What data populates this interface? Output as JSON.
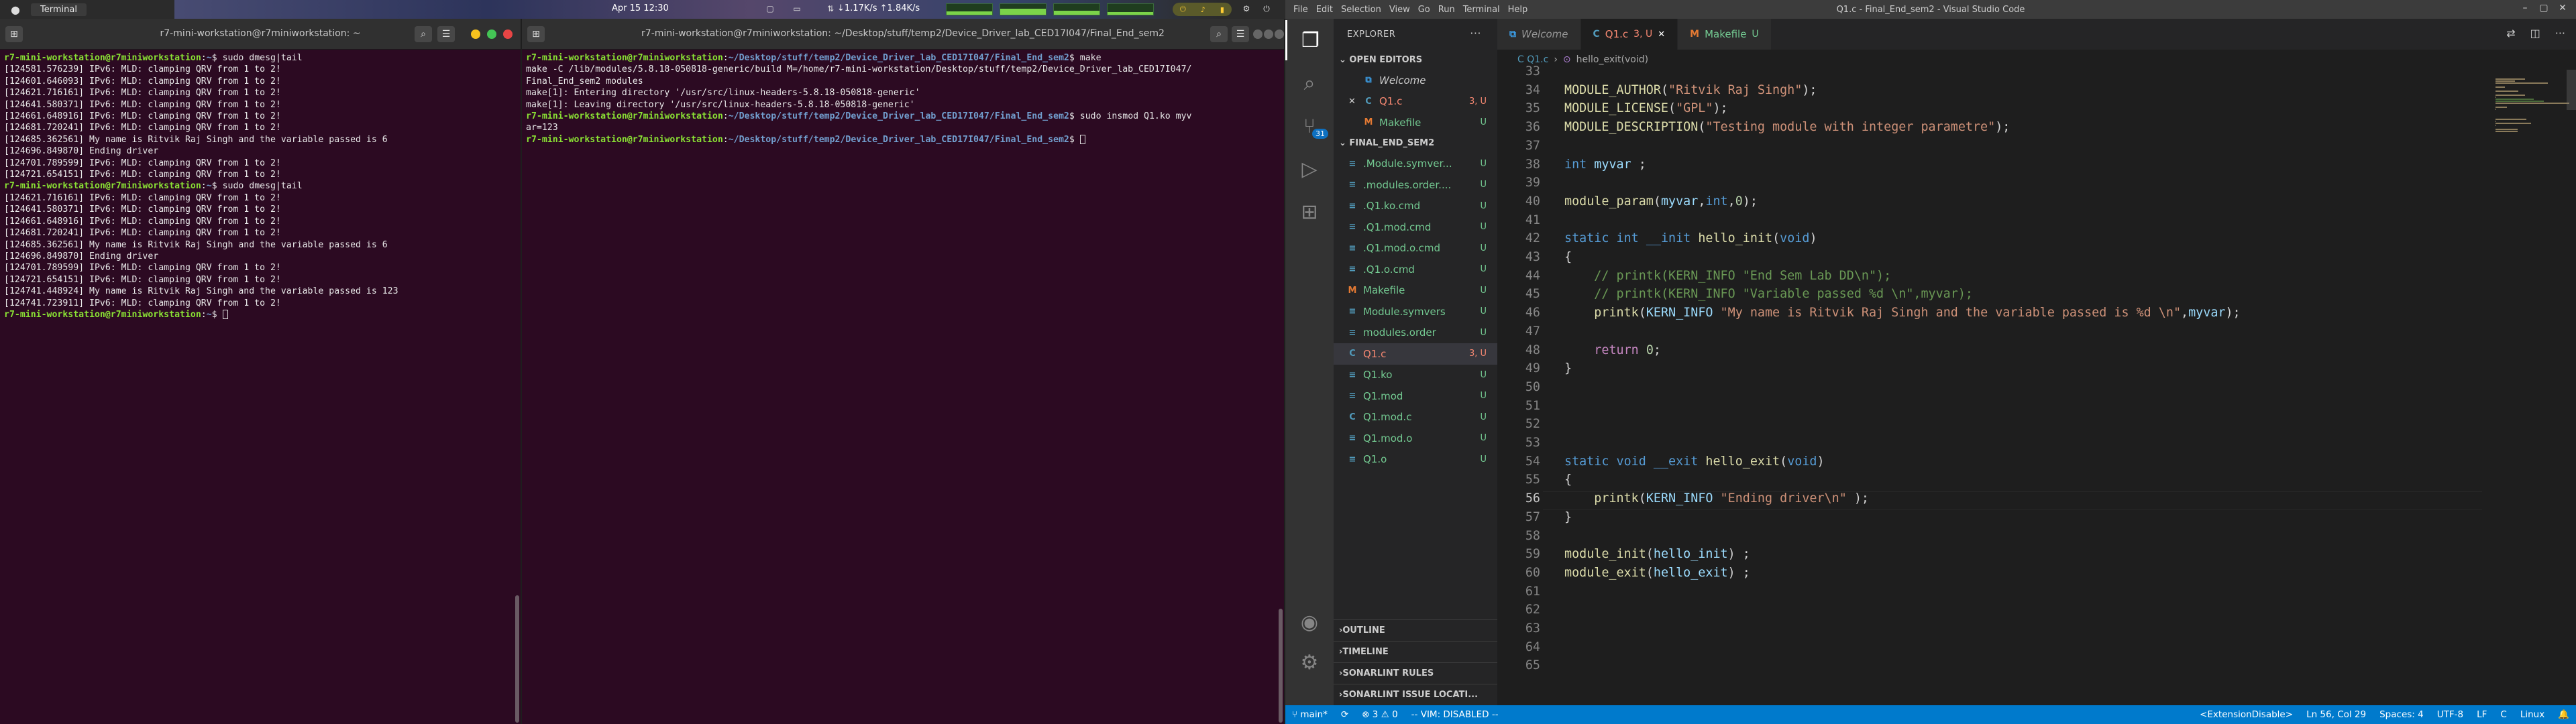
{
  "panel": {
    "app_name": "Terminal",
    "clock": "Apr 15  12:30",
    "net_speed": "↓1.17K/s  ↑1.84K/s",
    "graphs": [
      {
        "level": 0.3
      },
      {
        "level": 0.55
      },
      {
        "level": 0.4
      },
      {
        "level": 0.25
      }
    ]
  },
  "terminal_left": {
    "title": "r7-mini-workstation@r7miniworkstation: ~",
    "lines": [
      {
        "type": "prompt",
        "user": "r7-mini-workstation@r7miniworkstation",
        "path": "~",
        "cmd": "sudo dmesg|tail"
      },
      {
        "type": "text",
        "text": "[124581.576239] IPv6: MLD: clamping QRV from 1 to 2!"
      },
      {
        "type": "text",
        "text": "[124601.646093] IPv6: MLD: clamping QRV from 1 to 2!"
      },
      {
        "type": "text",
        "text": "[124621.716161] IPv6: MLD: clamping QRV from 1 to 2!"
      },
      {
        "type": "text",
        "text": "[124641.580371] IPv6: MLD: clamping QRV from 1 to 2!"
      },
      {
        "type": "text",
        "text": "[124661.648916] IPv6: MLD: clamping QRV from 1 to 2!"
      },
      {
        "type": "text",
        "text": "[124681.720241] IPv6: MLD: clamping QRV from 1 to 2!"
      },
      {
        "type": "text",
        "text": "[124685.362561] My name is Ritvik Raj Singh and the variable passed is 6"
      },
      {
        "type": "text",
        "text": "[124696.849870] Ending driver"
      },
      {
        "type": "text",
        "text": "[124701.789599] IPv6: MLD: clamping QRV from 1 to 2!"
      },
      {
        "type": "text",
        "text": "[124721.654151] IPv6: MLD: clamping QRV from 1 to 2!"
      },
      {
        "type": "prompt",
        "user": "r7-mini-workstation@r7miniworkstation",
        "path": "~",
        "cmd": "sudo dmesg|tail"
      },
      {
        "type": "text",
        "text": "[124621.716161] IPv6: MLD: clamping QRV from 1 to 2!"
      },
      {
        "type": "text",
        "text": "[124641.580371] IPv6: MLD: clamping QRV from 1 to 2!"
      },
      {
        "type": "text",
        "text": "[124661.648916] IPv6: MLD: clamping QRV from 1 to 2!"
      },
      {
        "type": "text",
        "text": "[124681.720241] IPv6: MLD: clamping QRV from 1 to 2!"
      },
      {
        "type": "text",
        "text": "[124685.362561] My name is Ritvik Raj Singh and the variable passed is 6"
      },
      {
        "type": "text",
        "text": "[124696.849870] Ending driver"
      },
      {
        "type": "text",
        "text": "[124701.789599] IPv6: MLD: clamping QRV from 1 to 2!"
      },
      {
        "type": "text",
        "text": "[124721.654151] IPv6: MLD: clamping QRV from 1 to 2!"
      },
      {
        "type": "text",
        "text": "[124741.448924] My name is Ritvik Raj Singh and the variable passed is 123"
      },
      {
        "type": "text",
        "text": "[124741.723911] IPv6: MLD: clamping QRV from 1 to 2!"
      },
      {
        "type": "prompt",
        "user": "r7-mini-workstation@r7miniworkstation",
        "path": "~",
        "cmd": "",
        "cursor": true
      }
    ]
  },
  "terminal_right": {
    "title": "r7-mini-workstation@r7miniworkstation: ~/Desktop/stuff/temp2/Device_Driver_lab_CED17I047/Final_End_sem2",
    "lines": [
      {
        "type": "prompt",
        "user": "r7-mini-workstation@r7miniworkstation",
        "path": "~/Desktop/stuff/temp2/Device_Driver_lab_CED17I047/Final_End_sem2",
        "cmd": "make"
      },
      {
        "type": "text",
        "text": "make -C /lib/modules/5.8.18-050818-generic/build M=/home/r7-mini-workstation/Desktop/stuff/temp2/Device_Driver_lab_CED17I047/"
      },
      {
        "type": "text",
        "text": "Final_End_sem2 modules"
      },
      {
        "type": "text",
        "text": "make[1]: Entering directory '/usr/src/linux-headers-5.8.18-050818-generic'"
      },
      {
        "type": "text",
        "text": "make[1]: Leaving directory '/usr/src/linux-headers-5.8.18-050818-generic'"
      },
      {
        "type": "prompt",
        "user": "r7-mini-workstation@r7miniworkstation",
        "path": "~/Desktop/stuff/temp2/Device_Driver_lab_CED17I047/Final_End_sem2",
        "cmd": "sudo insmod Q1.ko myv"
      },
      {
        "type": "text",
        "text": "ar=123"
      },
      {
        "type": "prompt",
        "user": "r7-mini-workstation@r7miniworkstation",
        "path": "~/Desktop/stuff/temp2/Device_Driver_lab_CED17I047/Final_End_sem2",
        "cmd": "",
        "cursor": true
      }
    ]
  },
  "vscode": {
    "window_title": "Q1.c - Final_End_sem2 - Visual Studio Code",
    "menu": [
      "File",
      "Edit",
      "Selection",
      "View",
      "Go",
      "Run",
      "Terminal",
      "Help"
    ],
    "scm_badge": "31",
    "explorer_title": "EXPLORER",
    "open_editors_label": "OPEN EDITORS",
    "open_editors": [
      {
        "icon": "welcome",
        "label": "Welcome",
        "status": "",
        "italic": true,
        "close": false
      },
      {
        "icon": "C",
        "label": "Q1.c",
        "status": "3, U",
        "italic": false,
        "close": true
      },
      {
        "icon": "M",
        "label": "Makefile",
        "status": "U",
        "italic": false,
        "close": false
      }
    ],
    "folder_label": "FINAL_END_SEM2",
    "files": [
      {
        "icon": "≡",
        "label": ".Module.symver...",
        "status": "U",
        "color": "#73c991",
        "selected": false
      },
      {
        "icon": "≡",
        "label": ".modules.order....",
        "status": "U",
        "color": "#73c991",
        "selected": false
      },
      {
        "icon": "≡",
        "label": ".Q1.ko.cmd",
        "status": "U",
        "color": "#73c991",
        "selected": false
      },
      {
        "icon": "≡",
        "label": ".Q1.mod.cmd",
        "status": "U",
        "color": "#73c991",
        "selected": false
      },
      {
        "icon": "≡",
        "label": ".Q1.mod.o.cmd",
        "status": "U",
        "color": "#73c991",
        "selected": false
      },
      {
        "icon": "≡",
        "label": ".Q1.o.cmd",
        "status": "U",
        "color": "#73c991",
        "selected": false
      },
      {
        "icon": "M",
        "label": "Makefile",
        "status": "U",
        "color": "#73c991",
        "selected": false
      },
      {
        "icon": "≡",
        "label": "Module.symvers",
        "status": "U",
        "color": "#73c991",
        "selected": false
      },
      {
        "icon": "≡",
        "label": "modules.order",
        "status": "U",
        "color": "#73c991",
        "selected": false
      },
      {
        "icon": "C",
        "label": "Q1.c",
        "status": "3, U",
        "color": "#e2c08d",
        "selected": true
      },
      {
        "icon": "≡",
        "label": "Q1.ko",
        "status": "U",
        "color": "#73c991",
        "selected": false
      },
      {
        "icon": "≡",
        "label": "Q1.mod",
        "status": "U",
        "color": "#73c991",
        "selected": false
      },
      {
        "icon": "C",
        "label": "Q1.mod.c",
        "status": "U",
        "color": "#73c991",
        "selected": false
      },
      {
        "icon": "≡",
        "label": "Q1.mod.o",
        "status": "U",
        "color": "#73c991",
        "selected": false
      },
      {
        "icon": "≡",
        "label": "Q1.o",
        "status": "U",
        "color": "#73c991",
        "selected": false
      }
    ],
    "bottom_sections": [
      "OUTLINE",
      "TIMELINE",
      "SONARLINT RULES",
      "SONARLINT ISSUE LOCATI..."
    ],
    "tabs": [
      {
        "icon": "welcome",
        "label": "Welcome",
        "status": "",
        "active": false,
        "italic": true
      },
      {
        "icon": "C",
        "label": "Q1.c",
        "status": "3, U",
        "active": true,
        "italic": false
      },
      {
        "icon": "M",
        "label": "Makefile",
        "status": "U",
        "active": false,
        "italic": false
      }
    ],
    "breadcrumb": [
      "C  Q1.c",
      "hello_exit(void)"
    ],
    "code_lines": [
      {
        "n": "33",
        "html": ""
      },
      {
        "n": "34",
        "html": "<span class='f'>MODULE_AUTHOR</span>(<span class='s'>\"Ritvik Raj Singh\"</span>);"
      },
      {
        "n": "35",
        "html": "<span class='f'>MODULE_LICENSE</span>(<span class='s'>\"GPL\"</span>);"
      },
      {
        "n": "36",
        "html": "<span class='f'>MODULE_DESCRIPTION</span>(<span class='s'>\"Testing module with integer parametre\"</span>);"
      },
      {
        "n": "37",
        "html": ""
      },
      {
        "n": "38",
        "html": "<span class='k'>int</span> <span class='v'>myvar</span> ;"
      },
      {
        "n": "39",
        "html": ""
      },
      {
        "n": "40",
        "html": "<span class='f'>module_param</span>(<span class='v'>myvar</span>,<span class='k'>int</span>,<span class='n'>0</span>);"
      },
      {
        "n": "41",
        "html": ""
      },
      {
        "n": "42",
        "html": "<span class='k'>static</span> <span class='k'>int</span> <span class='k'>__init</span> <span class='f'>hello_init</span>(<span class='k'>void</span>)"
      },
      {
        "n": "43",
        "html": "{"
      },
      {
        "n": "44",
        "html": "    <span class='c'>// printk(KERN_INFO \"End Sem Lab DD\\n\");</span>"
      },
      {
        "n": "45",
        "html": "    <span class='c'>// printk(KERN_INFO \"Variable passed %d \\n\",myvar);</span>"
      },
      {
        "n": "46",
        "html": "    <span class='f'>printk</span>(<span class='v'>KERN_INFO</span> <span class='s'>\"My name is Ritvik Raj Singh and the variable passed is %d \\n\"</span>,<span class='v'>myvar</span>);"
      },
      {
        "n": "47",
        "html": ""
      },
      {
        "n": "48",
        "html": "    <span class='m'>return</span> <span class='n'>0</span>;"
      },
      {
        "n": "49",
        "html": "}"
      },
      {
        "n": "50",
        "html": ""
      },
      {
        "n": "51",
        "html": ""
      },
      {
        "n": "52",
        "html": ""
      },
      {
        "n": "53",
        "html": ""
      },
      {
        "n": "54",
        "html": "<span class='k'>static</span> <span class='k'>void</span> <span class='k'>__exit</span> <span class='f'>hello_exit</span>(<span class='k'>void</span>)"
      },
      {
        "n": "55",
        "html": "{"
      },
      {
        "n": "56",
        "html": "    <span class='f'>printk</span>(<span class='v'>KERN_INFO</span> <span class='s'>\"Ending driver\\n\"</span> );"
      },
      {
        "n": "57",
        "html": "}"
      },
      {
        "n": "58",
        "html": ""
      },
      {
        "n": "59",
        "html": "<span class='f'>module_init</span>(<span class='v'>hello_init</span>) ;"
      },
      {
        "n": "60",
        "html": "<span class='f'>module_exit</span>(<span class='v'>hello_exit</span>) ;"
      },
      {
        "n": "61",
        "html": ""
      },
      {
        "n": "62",
        "html": ""
      },
      {
        "n": "63",
        "html": ""
      },
      {
        "n": "64",
        "html": ""
      },
      {
        "n": "65",
        "html": ""
      }
    ],
    "current_line": "56",
    "status": {
      "branch": "main*",
      "problems": "⊗ 3  ⚠ 0",
      "vim": "-- VIM: DISABLED --",
      "extension": "<ExtensionDisable>",
      "position": "Ln 56, Col 29",
      "spaces": "Spaces: 4",
      "encoding": "UTF-8",
      "eol": "LF",
      "language": "C",
      "os": "Linux"
    }
  }
}
